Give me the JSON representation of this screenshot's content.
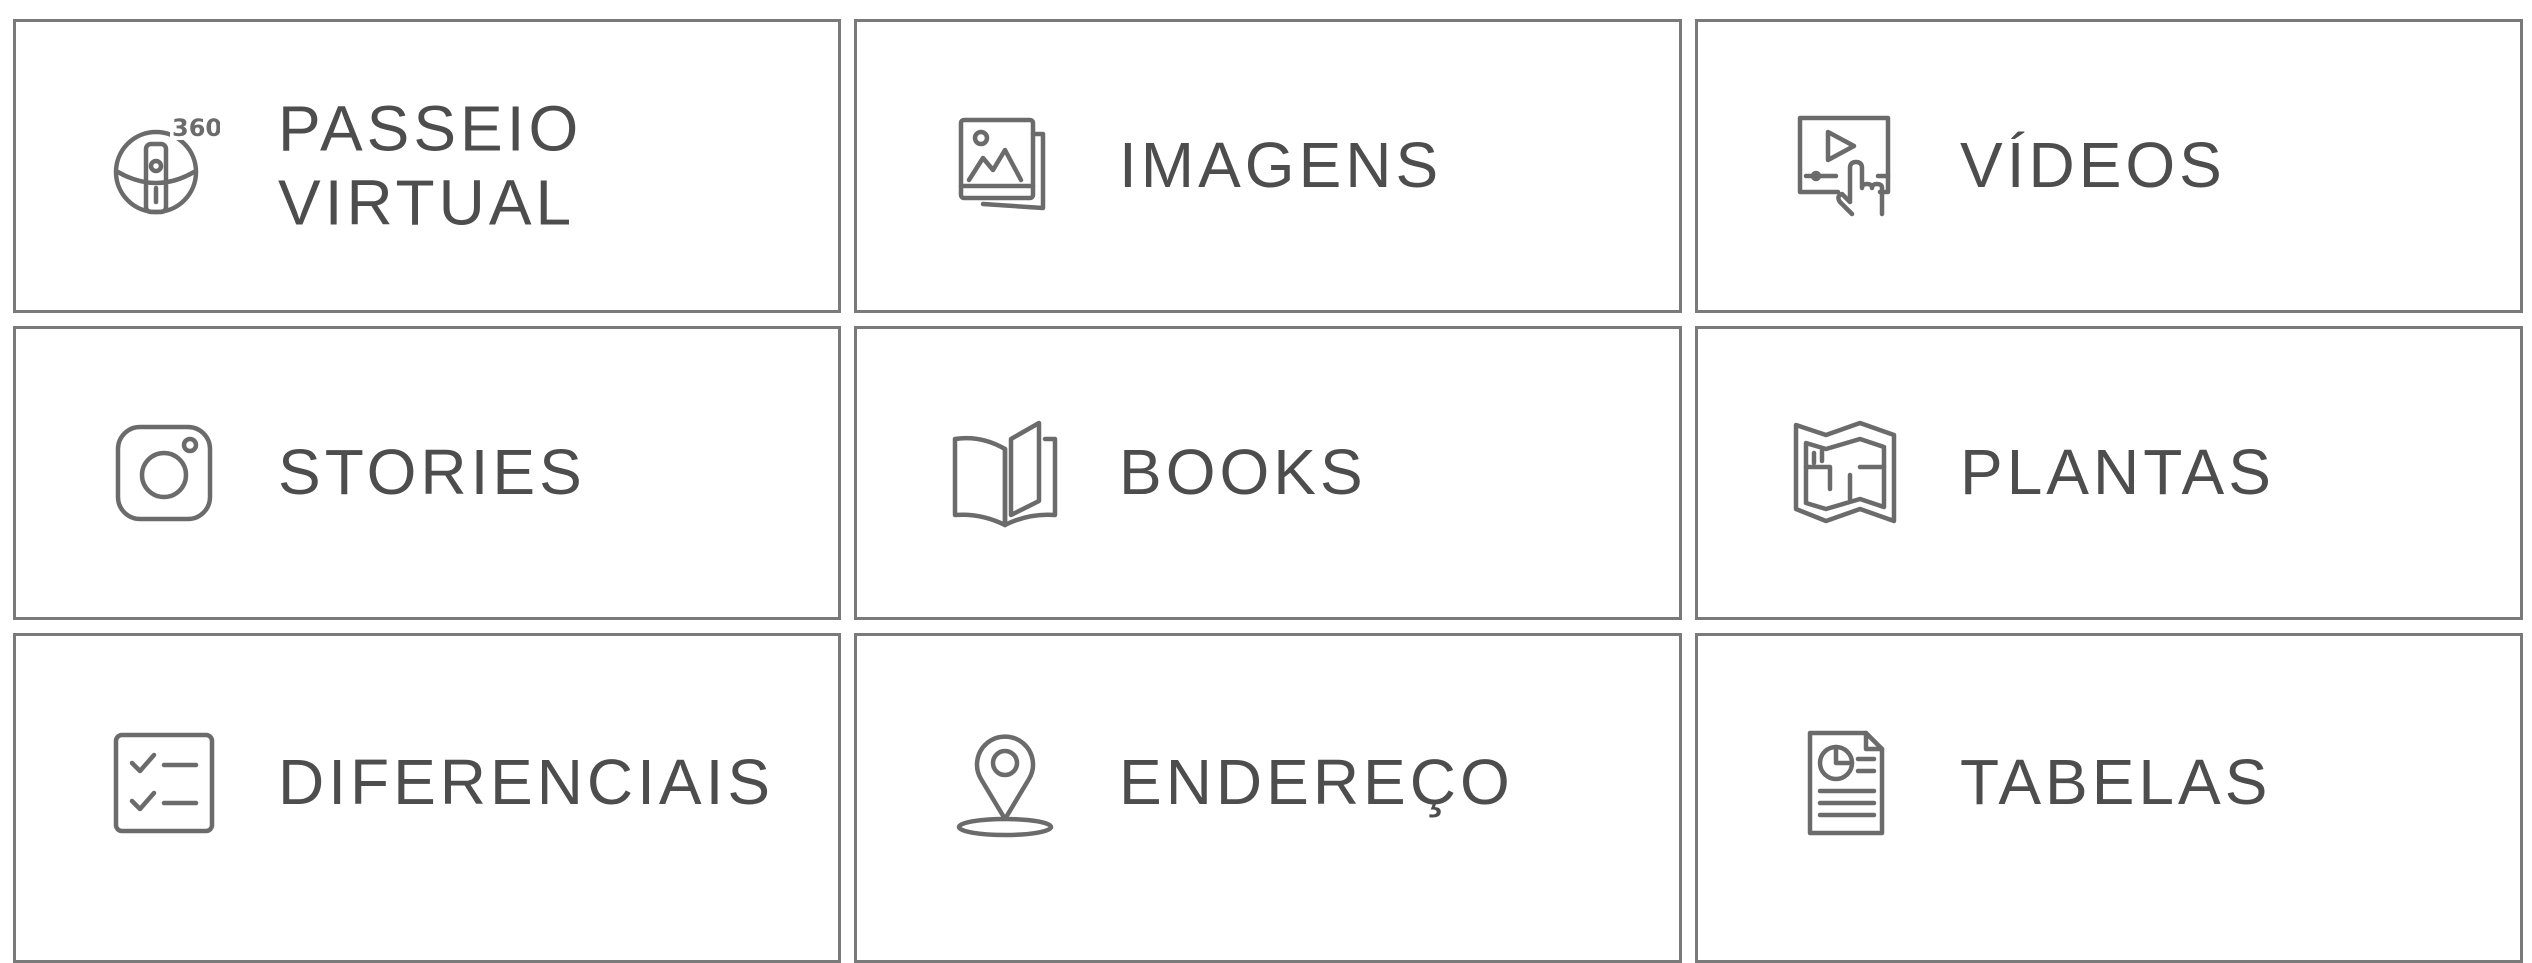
{
  "tiles": [
    {
      "label_lines": [
        "PASSEIO",
        "VIRTUAL"
      ],
      "icon": "360-view-icon",
      "icon_badge": "360"
    },
    {
      "label": "IMAGENS",
      "icon": "images-icon"
    },
    {
      "label": "VÍDEOS",
      "icon": "video-touch-icon"
    },
    {
      "label": "STORIES",
      "icon": "instagram-icon"
    },
    {
      "label": "BOOKS",
      "icon": "book-icon"
    },
    {
      "label": "PLANTAS",
      "icon": "map-plan-icon"
    },
    {
      "label": "DIFERENCIAIS",
      "icon": "checklist-icon"
    },
    {
      "label": "ENDEREÇO",
      "icon": "location-pin-icon"
    },
    {
      "label": "TABELAS",
      "icon": "report-document-icon"
    }
  ],
  "colors": {
    "border": "#7a7a7a",
    "text": "#4d4d4d",
    "icon": "#6b6b6b",
    "background": "#ffffff"
  }
}
